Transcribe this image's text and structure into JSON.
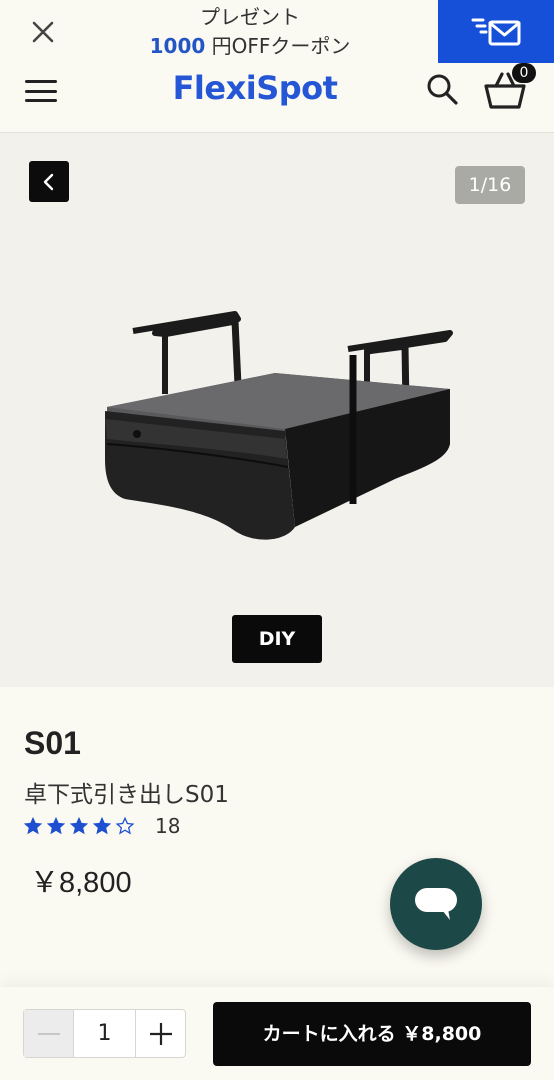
{
  "promo": {
    "line1": "プレゼント",
    "amount": "1000",
    "line2_rest": " 円OFFクーポン",
    "close_icon": "close-icon",
    "mail_icon": "mail-icon",
    "mail_bg": "#1650d8"
  },
  "header": {
    "logo": "FlexiSpot",
    "logo_color": "#2456d6",
    "cart_count": "0"
  },
  "gallery": {
    "counter": "1/16",
    "badge": "DIY"
  },
  "product": {
    "model": "S01",
    "name": "卓下式引き出しS01",
    "rating": 4,
    "rating_max": 5,
    "review_count": "18",
    "price": "￥8,800",
    "star_color": "#1d4fd0"
  },
  "chat": {
    "icon": "chat-bubble-icon",
    "bg": "#1c4848"
  },
  "purchase": {
    "quantity": "1",
    "add_to_cart": "カートに入れる ￥8,800"
  }
}
